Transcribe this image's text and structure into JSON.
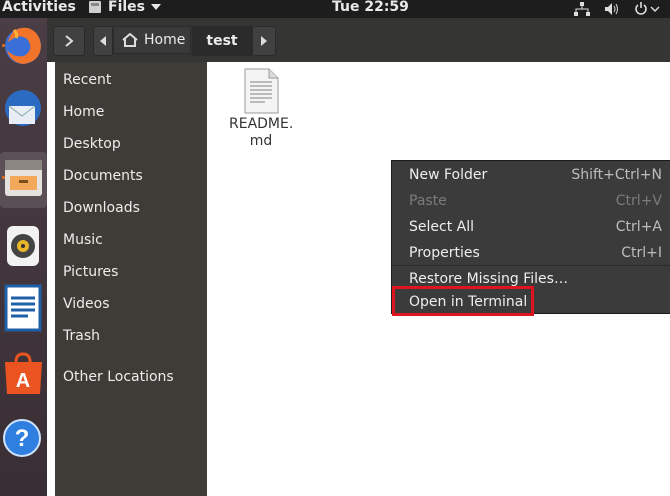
{
  "topbar": {
    "activities": "Activities",
    "app_name": "Files",
    "clock": "Tue 22:59"
  },
  "headerbar": {
    "breadcrumb_home": "Home",
    "breadcrumb_current": "test"
  },
  "sidebar": {
    "items": [
      {
        "label": "Recent"
      },
      {
        "label": "Home"
      },
      {
        "label": "Desktop"
      },
      {
        "label": "Documents"
      },
      {
        "label": "Downloads"
      },
      {
        "label": "Music"
      },
      {
        "label": "Pictures"
      },
      {
        "label": "Videos"
      },
      {
        "label": "Trash"
      },
      {
        "label": "Other Locations"
      }
    ]
  },
  "files": [
    {
      "name_line1": "README.",
      "name_line2": "md"
    }
  ],
  "context_menu": {
    "items": [
      {
        "label": "New Folder",
        "shortcut": "Shift+Ctrl+N",
        "enabled": true
      },
      {
        "label": "Paste",
        "shortcut": "Ctrl+V",
        "enabled": false
      },
      {
        "label": "Select All",
        "shortcut": "Ctrl+A",
        "enabled": true
      },
      {
        "label": "Properties",
        "shortcut": "Ctrl+I",
        "enabled": true
      },
      {
        "label": "Restore Missing Files…",
        "shortcut": "",
        "enabled": true
      },
      {
        "label": "Open in Terminal",
        "shortcut": "",
        "enabled": true
      }
    ]
  },
  "dock": {
    "apps": [
      "firefox-icon",
      "thunderbird-icon",
      "files-icon",
      "rhythmbox-icon",
      "libreoffice-writer-icon",
      "software-center-icon",
      "help-icon"
    ]
  },
  "colors": {
    "highlight": "#e0141e",
    "accent": "#e86d1e"
  }
}
